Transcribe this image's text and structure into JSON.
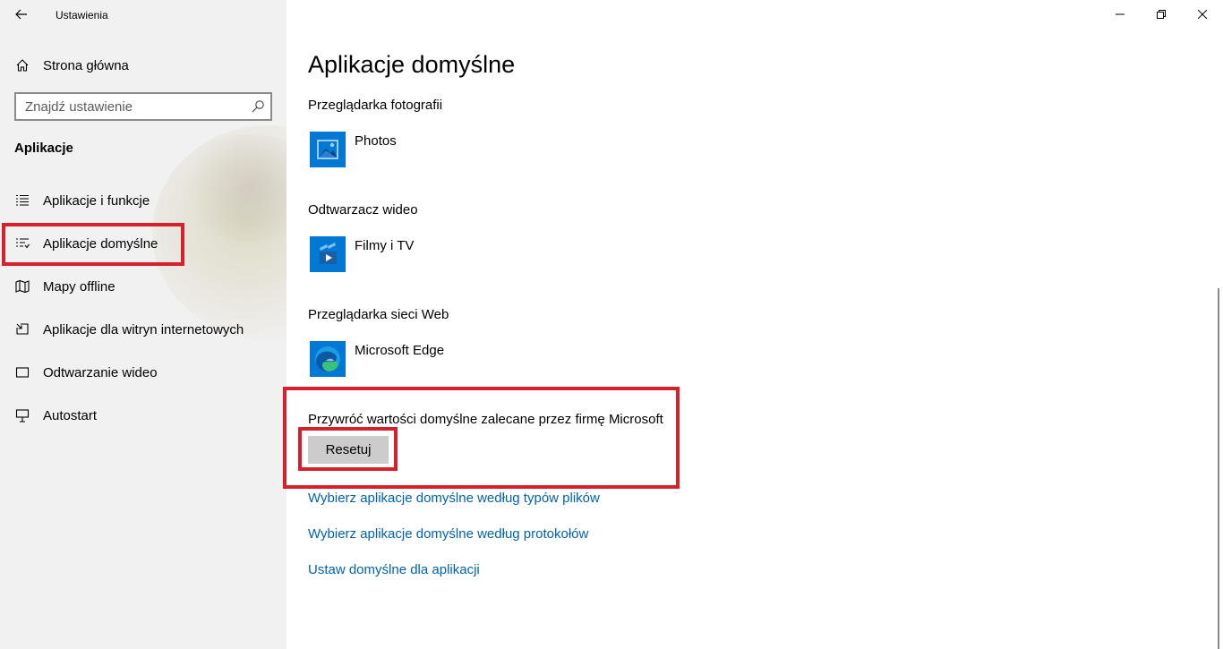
{
  "window": {
    "title": "Ustawienia",
    "colors": {
      "accent": "#0078d4",
      "link": "#0063b1",
      "highlight": "#d6202b",
      "sidebar_bg": "#f1f1f1"
    }
  },
  "sidebar": {
    "back_icon": "back-arrow-icon",
    "home": {
      "label": "Strona główna",
      "icon": "home-icon"
    },
    "search": {
      "value": "",
      "placeholder": "Znajdź ustawienie",
      "icon": "search-icon"
    },
    "section_title": "Aplikacje",
    "items": [
      {
        "label": "Aplikacje i funkcje",
        "icon": "apps-features-icon",
        "selected": false
      },
      {
        "label": "Aplikacje domyślne",
        "icon": "default-apps-icon",
        "selected": true
      },
      {
        "label": "Mapy offline",
        "icon": "offline-maps-icon",
        "selected": false
      },
      {
        "label": "Aplikacje dla witryn internetowych",
        "icon": "apps-for-websites-icon",
        "selected": false
      },
      {
        "label": "Odtwarzanie wideo",
        "icon": "video-playback-icon",
        "selected": false
      },
      {
        "label": "Autostart",
        "icon": "startup-icon",
        "selected": false
      }
    ]
  },
  "main": {
    "title": "Aplikacje domyślne",
    "categories": [
      {
        "label": "Przeglądarka fotografii",
        "app": "Photos",
        "icon": "photos-app-icon"
      },
      {
        "label": "Odtwarzacz wideo",
        "app": "Filmy i TV",
        "icon": "movies-tv-app-icon"
      },
      {
        "label": "Przeglądarka sieci Web",
        "app": "Microsoft Edge",
        "icon": "edge-browser-icon"
      }
    ],
    "reset": {
      "text": "Przywróć wartości domyślne zalecane przez firmę Microsoft",
      "button_label": "Resetuj"
    },
    "links": [
      "Wybierz aplikacje domyślne według typów plików",
      "Wybierz aplikacje domyślne według protokołów",
      "Ustaw domyślne dla aplikacji"
    ]
  }
}
